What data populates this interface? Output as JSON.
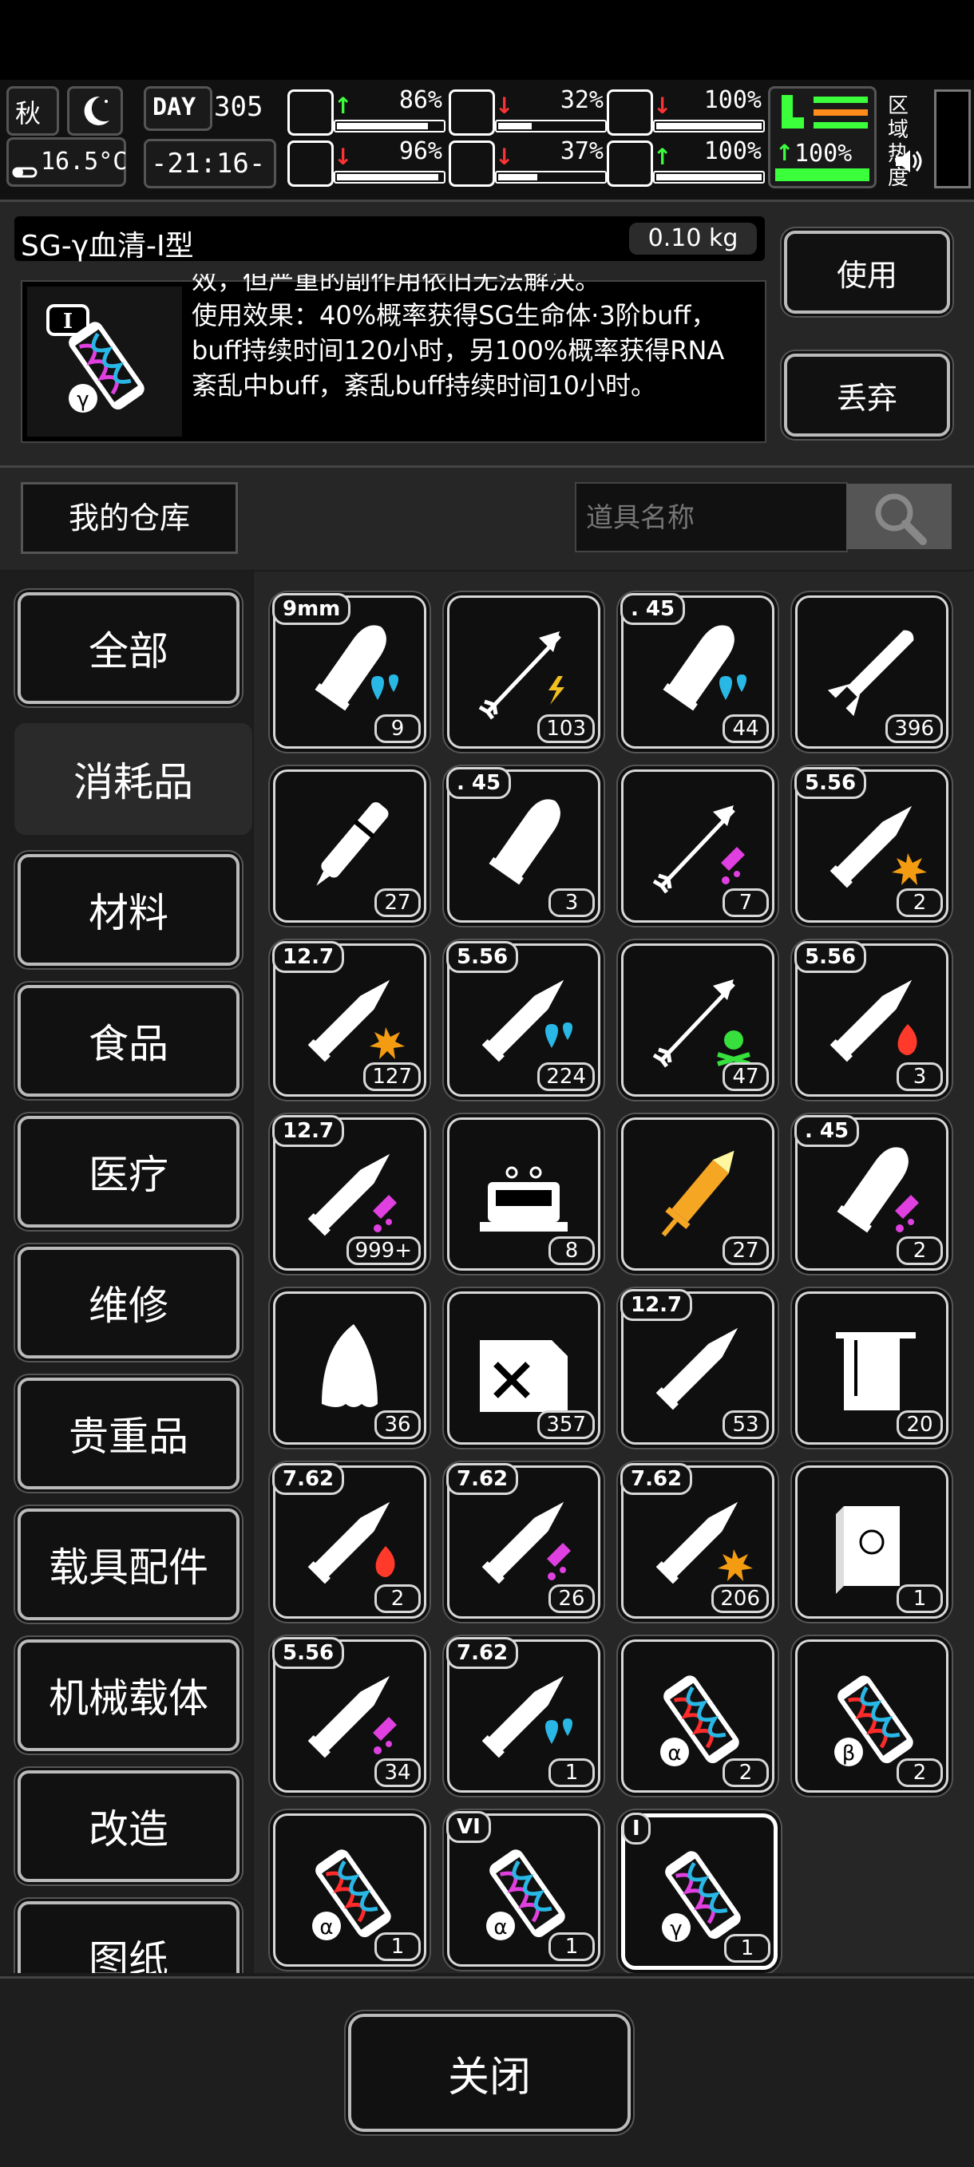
{
  "hud": {
    "season": "秋",
    "temperature": "16.5°C",
    "day_label": "DAY",
    "day_number": "305",
    "clock": "-21:16-",
    "zone_heat": "区域热度",
    "stats": [
      {
        "name": "health",
        "arrow": "↑",
        "arrow_color": "#3cff3c",
        "value": "86%",
        "level": 0.86
      },
      {
        "name": "hunger",
        "arrow": "↓",
        "arrow_color": "#ff3333",
        "value": "32%",
        "level": 0.32
      },
      {
        "name": "armor",
        "arrow": "↓",
        "arrow_color": "#ff3333",
        "value": "100%",
        "level": 1.0
      },
      {
        "name": "sanity",
        "arrow": "↓",
        "arrow_color": "#ff3333",
        "value": "96%",
        "level": 0.96
      },
      {
        "name": "thirst",
        "arrow": "↓",
        "arrow_color": "#ff3333",
        "value": "37%",
        "level": 0.37
      },
      {
        "name": "heart",
        "arrow": "↑",
        "arrow_color": "#3cff3c",
        "value": "100%",
        "level": 1.0
      }
    ],
    "stamina": {
      "arrow": "↑",
      "value": "100%",
      "level": 1.0
    }
  },
  "item": {
    "name": "SG-γ血清-Ⅰ型",
    "weight": "0.10 kg",
    "tier": "I",
    "description_lines": [
      "效，但严重的副作用依旧无法解决。",
      "使用效果：40%概率获得SG生命体·3阶buff，",
      "buff持续时间120小时，另100%概率获得RNA",
      "紊乱中buff，紊乱buff持续时间10小时。"
    ],
    "use_label": "使用",
    "discard_label": "丢弃"
  },
  "storage": {
    "title": "我的仓库",
    "search_placeholder": "道具名称"
  },
  "categories": [
    "全部",
    "消耗品",
    "材料",
    "食品",
    "医疗",
    "维修",
    "贵重品",
    "载具配件",
    "机械载体",
    "改造",
    "图纸"
  ],
  "active_category": 1,
  "items": [
    {
      "label": "9mm",
      "count": "9",
      "icon": "bullet-icon",
      "badge": "water"
    },
    {
      "label": "",
      "count": "103",
      "icon": "arrow-icon",
      "badge": "lightning"
    },
    {
      "label": ". 45",
      "count": "44",
      "icon": "bullet-icon",
      "badge": "water"
    },
    {
      "label": "",
      "count": "396",
      "icon": "rocket-icon",
      "badge": ""
    },
    {
      "label": "",
      "count": "27",
      "icon": "pen-icon",
      "badge": ""
    },
    {
      "label": ". 45",
      "count": "3",
      "icon": "bullet-icon",
      "badge": ""
    },
    {
      "label": "",
      "count": "7",
      "icon": "arrow-icon",
      "badge": "poison"
    },
    {
      "label": "5.56",
      "count": "2",
      "icon": "rifle-round-icon",
      "badge": "explosive"
    },
    {
      "label": "12.7",
      "count": "127",
      "icon": "rifle-round-icon",
      "badge": "explosive"
    },
    {
      "label": "5.56",
      "count": "224",
      "icon": "rifle-round-icon",
      "badge": "water"
    },
    {
      "label": "",
      "count": "47",
      "icon": "arrow-icon",
      "badge": "toxic"
    },
    {
      "label": "5.56",
      "count": "3",
      "icon": "rifle-round-icon",
      "badge": "fire"
    },
    {
      "label": "12.7",
      "count": "999+",
      "icon": "rifle-round-icon",
      "badge": "poison"
    },
    {
      "label": "",
      "count": "8",
      "icon": "machine-icon",
      "badge": ""
    },
    {
      "label": "",
      "count": "27",
      "icon": "syringe-icon",
      "badge": ""
    },
    {
      "label": ". 45",
      "count": "2",
      "icon": "bullet-icon",
      "badge": "poison"
    },
    {
      "label": "",
      "count": "36",
      "icon": "cloth-icon",
      "badge": ""
    },
    {
      "label": "",
      "count": "357",
      "icon": "fuel-can-icon",
      "badge": ""
    },
    {
      "label": "12.7",
      "count": "53",
      "icon": "rifle-round-icon",
      "badge": ""
    },
    {
      "label": "",
      "count": "20",
      "icon": "towel-icon",
      "badge": ""
    },
    {
      "label": "7.62",
      "count": "2",
      "icon": "rifle-round-icon",
      "badge": "fire"
    },
    {
      "label": "7.62",
      "count": "26",
      "icon": "rifle-round-icon",
      "badge": "poison"
    },
    {
      "label": "7.62",
      "count": "206",
      "icon": "rifle-round-icon",
      "badge": "explosive"
    },
    {
      "label": "",
      "count": "1",
      "icon": "book-icon",
      "badge": ""
    },
    {
      "label": "5.56",
      "count": "34",
      "icon": "rifle-round-icon",
      "badge": "poison"
    },
    {
      "label": "7.62",
      "count": "1",
      "icon": "rifle-round-icon",
      "badge": "water"
    },
    {
      "label": "",
      "count": "2",
      "icon": "serum-icon",
      "badge": "alpha-red"
    },
    {
      "label": "",
      "count": "2",
      "icon": "serum-icon",
      "badge": "beta-red"
    },
    {
      "label": "",
      "count": "1",
      "icon": "serum-icon",
      "badge": "alpha-red"
    },
    {
      "label": "VI",
      "count": "1",
      "icon": "serum-icon",
      "badge": "alpha-purple"
    },
    {
      "label": "I",
      "count": "1",
      "icon": "serum-icon",
      "badge": "gamma-purple"
    }
  ],
  "selected_item": 30,
  "close_label": "关闭",
  "colors": {
    "water": "#29b8e6",
    "lightning": "#f0c020",
    "poison": "#e040e0",
    "explosive": "#f39c12",
    "fire": "#ff3a2a",
    "toxic": "#37e03c",
    "syringe": "#f5a623"
  }
}
